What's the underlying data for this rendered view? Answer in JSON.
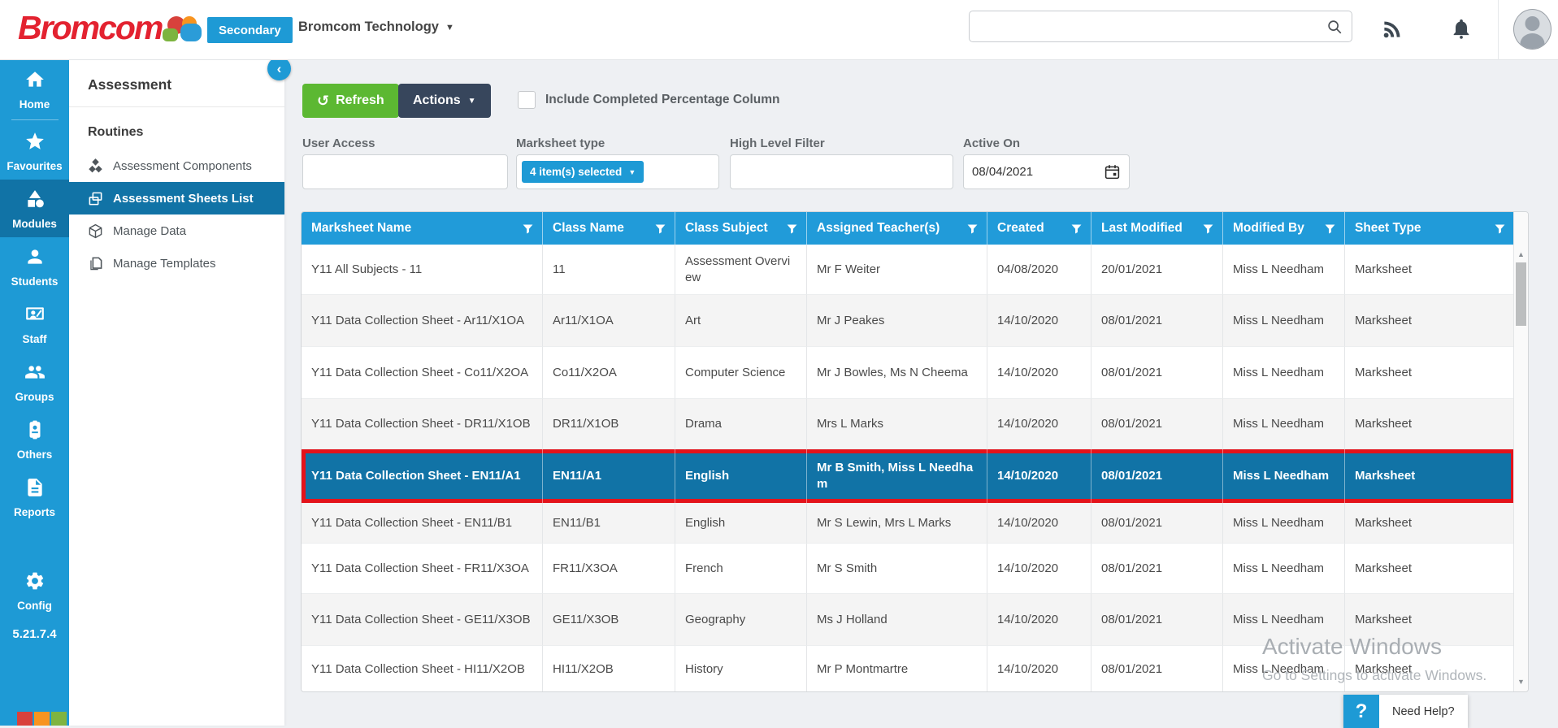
{
  "topbar": {
    "logo_text": "Bromcom",
    "badge": "Secondary",
    "org_name": "Bromcom Technology",
    "search_placeholder": ""
  },
  "sidebar": {
    "items": [
      {
        "label": "Home",
        "icon": "home-icon",
        "selected": false
      },
      {
        "label": "Favourites",
        "icon": "star-icon",
        "selected": false
      },
      {
        "label": "Modules",
        "icon": "modules-icon",
        "selected": true
      },
      {
        "label": "Students",
        "icon": "student-icon",
        "selected": false
      },
      {
        "label": "Staff",
        "icon": "staff-icon",
        "selected": false
      },
      {
        "label": "Groups",
        "icon": "groups-icon",
        "selected": false
      },
      {
        "label": "Others",
        "icon": "badge-icon",
        "selected": false
      },
      {
        "label": "Reports",
        "icon": "report-icon",
        "selected": false
      },
      {
        "label": "Config",
        "icon": "gear-icon",
        "selected": false
      }
    ],
    "version": "5.21.7.4",
    "footer_squares": [
      "#1e9ad5",
      "#d8413c",
      "#f89420",
      "#7fb441"
    ]
  },
  "panel": {
    "title": "Assessment",
    "section": "Routines",
    "items": [
      {
        "label": "Assessment Components",
        "icon": "components-icon",
        "selected": false
      },
      {
        "label": "Assessment Sheets List",
        "icon": "sheets-icon",
        "selected": true
      },
      {
        "label": "Manage Data",
        "icon": "cube-icon",
        "selected": false
      },
      {
        "label": "Manage Templates",
        "icon": "templates-icon",
        "selected": false
      }
    ]
  },
  "toolbar": {
    "refresh_label": "Refresh",
    "actions_label": "Actions",
    "checkbox_label": "Include Completed Percentage Column",
    "checkbox_checked": false
  },
  "filters": {
    "user_access_label": "User Access",
    "user_access_value": "",
    "marksheet_type_label": "Marksheet type",
    "marksheet_type_value": "4 item(s) selected",
    "high_level_filter_label": "High Level Filter",
    "high_level_filter_value": "",
    "active_on_label": "Active On",
    "active_on_value": "08/04/2021"
  },
  "table": {
    "columns": [
      "Marksheet Name",
      "Class Name",
      "Class Subject",
      "Assigned Teacher(s)",
      "Created",
      "Last Modified",
      "Modified By",
      "Sheet Type"
    ],
    "selected_row_index": 4,
    "rows": [
      {
        "marksheet": "Y11 All Subjects - 11",
        "class_name": "11",
        "subject": "Assessment Overview",
        "teachers": "Mr F Weiter",
        "created": "04/08/2020",
        "modified": "20/01/2021",
        "modified_by": "Miss L Needham",
        "sheet_type": "Marksheet"
      },
      {
        "marksheet": "Y11 Data Collection Sheet - Ar11/X1OA",
        "class_name": "Ar11/X1OA",
        "subject": "Art",
        "teachers": "Mr J Peakes",
        "created": "14/10/2020",
        "modified": "08/01/2021",
        "modified_by": "Miss L Needham",
        "sheet_type": "Marksheet"
      },
      {
        "marksheet": "Y11 Data Collection Sheet - Co11/X2OA",
        "class_name": "Co11/X2OA",
        "subject": "Computer Science",
        "teachers": "Mr J Bowles, Ms N Cheema",
        "created": "14/10/2020",
        "modified": "08/01/2021",
        "modified_by": "Miss L Needham",
        "sheet_type": "Marksheet"
      },
      {
        "marksheet": "Y11 Data Collection Sheet - DR11/X1OB",
        "class_name": "DR11/X1OB",
        "subject": "Drama",
        "teachers": "Mrs L Marks",
        "created": "14/10/2020",
        "modified": "08/01/2021",
        "modified_by": "Miss L Needham",
        "sheet_type": "Marksheet"
      },
      {
        "marksheet": "Y11 Data Collection Sheet - EN11/A1",
        "class_name": "EN11/A1",
        "subject": "English",
        "teachers": "Mr B Smith, Miss L Needham",
        "created": "14/10/2020",
        "modified": "08/01/2021",
        "modified_by": "Miss L Needham",
        "sheet_type": "Marksheet"
      },
      {
        "marksheet": "Y11 Data Collection Sheet - EN11/B1",
        "class_name": "EN11/B1",
        "subject": "English",
        "teachers": "Mr S Lewin, Mrs L Marks",
        "created": "14/10/2020",
        "modified": "08/01/2021",
        "modified_by": "Miss L Needham",
        "sheet_type": "Marksheet"
      },
      {
        "marksheet": "Y11 Data Collection Sheet - FR11/X3OA",
        "class_name": "FR11/X3OA",
        "subject": "French",
        "teachers": "Mr S Smith",
        "created": "14/10/2020",
        "modified": "08/01/2021",
        "modified_by": "Miss L Needham",
        "sheet_type": "Marksheet"
      },
      {
        "marksheet": "Y11 Data Collection Sheet - GE11/X3OB",
        "class_name": "GE11/X3OB",
        "subject": "Geography",
        "teachers": "Ms J Holland",
        "created": "14/10/2020",
        "modified": "08/01/2021",
        "modified_by": "Miss L Needham",
        "sheet_type": "Marksheet"
      },
      {
        "marksheet": "Y11 Data Collection Sheet - HI11/X2OB",
        "class_name": "HI11/X2OB",
        "subject": "History",
        "teachers": "Mr P Montmartre",
        "created": "14/10/2020",
        "modified": "08/01/2021",
        "modified_by": "Miss L Needham",
        "sheet_type": "Marksheet"
      }
    ]
  },
  "overlay": {
    "watermark_line1": "Activate Windows",
    "watermark_line2": "Go to Settings to activate Windows.",
    "help_label": "Need Help?"
  },
  "colors": {
    "brand_blue": "#1e9ad5",
    "header_blue": "#219bd9",
    "selected_blue": "#1173a6",
    "selection_red": "#e3131b",
    "refresh_green": "#5cb832",
    "actions_dark": "#37465c",
    "logo_red": "#e32230"
  }
}
